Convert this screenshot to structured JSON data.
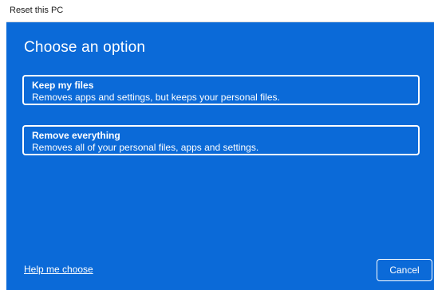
{
  "window": {
    "title": "Reset this PC"
  },
  "main": {
    "heading": "Choose an option",
    "options": [
      {
        "title": "Keep my files",
        "description": "Removes apps and settings, but keeps your personal files."
      },
      {
        "title": "Remove everything",
        "description": "Removes all of your personal files, apps and settings."
      }
    ]
  },
  "footer": {
    "help_link": "Help me choose",
    "cancel_label": "Cancel"
  },
  "colors": {
    "background": "#0b6ad8",
    "text": "#ffffff"
  }
}
